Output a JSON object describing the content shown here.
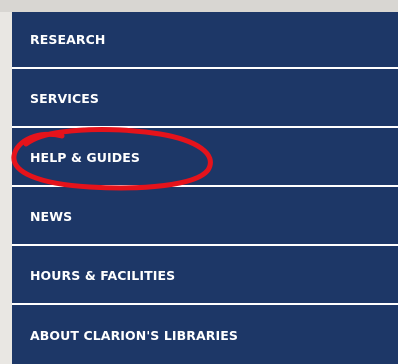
{
  "nav": {
    "items": [
      {
        "label": "RESEARCH"
      },
      {
        "label": "SERVICES"
      },
      {
        "label": "HELP & GUIDES"
      },
      {
        "label": "NEWS"
      },
      {
        "label": "HOURS & FACILITIES"
      },
      {
        "label": "ABOUT CLARION'S LIBRARIES"
      }
    ]
  },
  "annotation": {
    "type": "hand-drawn circle",
    "target": "HELP & GUIDES",
    "color": "#e5131b"
  },
  "colors": {
    "nav_background": "#1d3767",
    "nav_text": "#ffffff",
    "divider": "#ffffff"
  }
}
